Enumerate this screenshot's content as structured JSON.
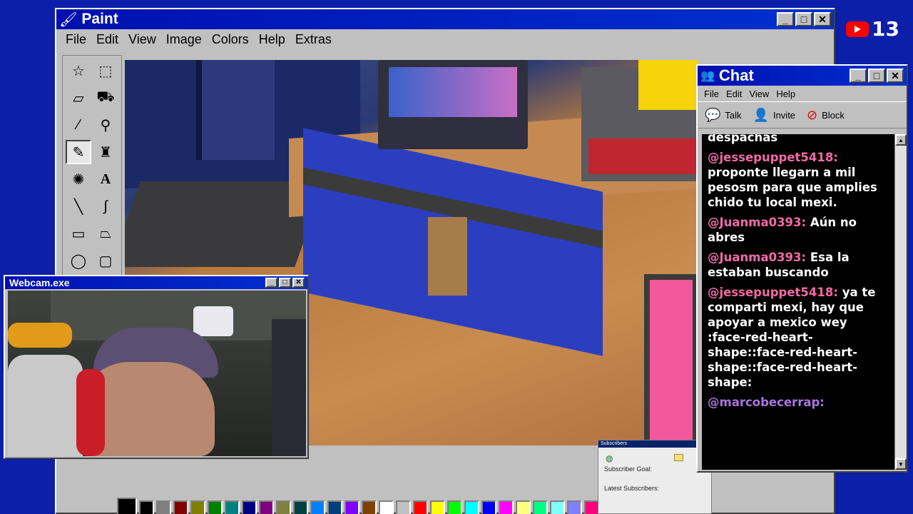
{
  "paint": {
    "title": "Paint",
    "menu": [
      "File",
      "Edit",
      "View",
      "Image",
      "Colors",
      "Help",
      "Extras"
    ]
  },
  "webcam": {
    "title": "Webcam.exe"
  },
  "chat": {
    "title": "Chat",
    "menu": [
      "File",
      "Edit",
      "View",
      "Help"
    ],
    "toolbar": {
      "talk": "Talk",
      "invite": "Invite",
      "block": "Block"
    },
    "messages": [
      {
        "user": "",
        "text": "despachas"
      },
      {
        "user": "@jessepuppet5418:",
        "text": "proponte llegarn a mil pesosm para que amplies chido tu local mexi."
      },
      {
        "user": "@Juanma0393:",
        "text": "Aún no abres"
      },
      {
        "user": "@Juanma0393:",
        "text": "Esa la estaban buscando"
      },
      {
        "user": "@jessepuppet5418:",
        "text": "ya te comparti mexi, hay que apoyar a mexico wey :face-red-heart-shape::face-red-heart-shape::face-red-heart-shape:"
      },
      {
        "user": "@marcobecerrap:",
        "text": ""
      }
    ]
  },
  "subscribers": {
    "title": "Subscribers",
    "goal_label": "Subscriber Goal:",
    "latest_label": "Latest Subscribers:"
  },
  "youtube_counter": "13",
  "palette_colors": [
    "#000000",
    "#808080",
    "#800000",
    "#808000",
    "#008000",
    "#008080",
    "#000080",
    "#800080",
    "#808040",
    "#004040",
    "#0080ff",
    "#004080",
    "#8000ff",
    "#804000",
    "#ffffff",
    "#c0c0c0",
    "#ff0000",
    "#ffff00",
    "#00ff00",
    "#00ffff",
    "#0000ff",
    "#ff00ff",
    "#ffff80",
    "#00ff80",
    "#80ffff",
    "#8080ff",
    "#ff0080",
    "#ff8040"
  ]
}
